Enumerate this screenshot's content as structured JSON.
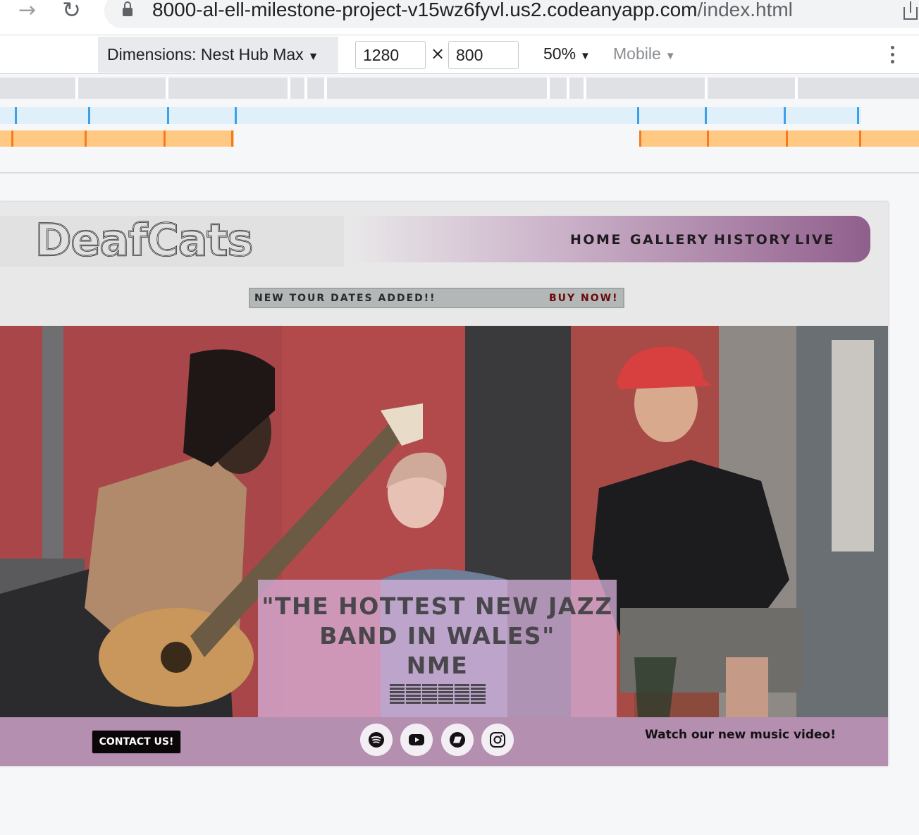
{
  "browser": {
    "url_host": "8000-al-ell-milestone-project-v15wz6fyvl.us2.codeanyapp.com",
    "url_path": "/index.html"
  },
  "devtools": {
    "device_label": "Dimensions: Nest Hub Max",
    "width": "1280",
    "height": "800",
    "times": "×",
    "zoom": "50%",
    "throttle": "Mobile"
  },
  "site": {
    "logo_text": "DeafCats",
    "nav": [
      "HOME",
      "GALLERY",
      "HISTORY",
      "LIVE"
    ],
    "banner": {
      "text": "NEW TOUR DATES ADDED!!",
      "cta": "BUY NOW!"
    },
    "quote": {
      "line1": "\"THE HOTTEST NEW JAZZ",
      "line2": "BAND IN WALES\"",
      "source": "NME",
      "rating": 5
    },
    "footer": {
      "contact": "CONTACT US!",
      "social": [
        "spotify-icon",
        "youtube-icon",
        "bandcamp-icon",
        "instagram-icon"
      ],
      "video": "Watch our new music video!"
    }
  },
  "colors": {
    "nav_gradient_end": "#8f5f8c",
    "footer": "#b48fb0",
    "quote_box": "#d7b2dc",
    "buy_now": "#6b0a0a"
  }
}
